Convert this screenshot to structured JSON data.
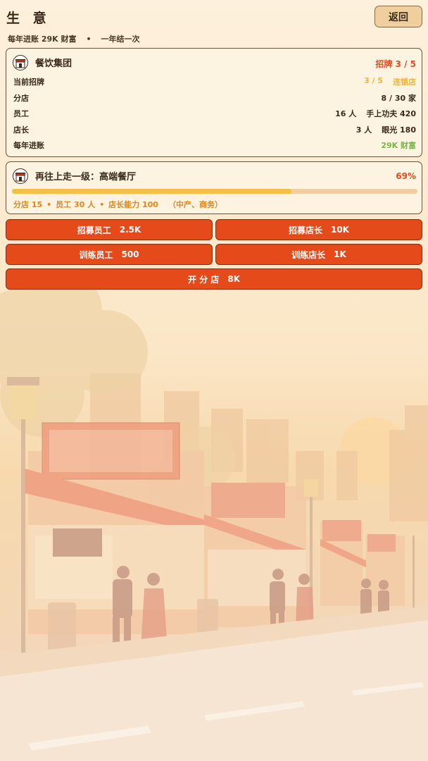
{
  "header": {
    "title": "生 意",
    "back_label": "返回",
    "income_label": "每年进账 29K 财富",
    "separator": "•",
    "cycle_label": "一年结一次"
  },
  "group_card": {
    "icon": "shop-icon",
    "title": "餐饮集团",
    "badge": "招牌 3 / 5",
    "rows": [
      {
        "label": "当前招牌",
        "value_a": "3 / 5",
        "value_b": "连锁店"
      },
      {
        "label": "分店",
        "value_a": "",
        "value_b": "8 / 30 家"
      },
      {
        "label": "员工",
        "value_a": "16 人",
        "value_b": "手上功夫 420"
      },
      {
        "label": "店长",
        "value_a": "3 人",
        "value_b": "眼光 180"
      },
      {
        "label": "每年进账",
        "value_a": "",
        "value_b": "29K 财富"
      }
    ]
  },
  "next_card": {
    "icon": "shop-icon",
    "title": "再往上走一级：高端餐厅",
    "progress_label": "69%",
    "progress": 0.69,
    "req_branches": "分店 15",
    "req_staff": "员工 30 人",
    "req_manager": "店长能力 100",
    "req_dot": "•",
    "req_tags": "（中产、商务）"
  },
  "actions": {
    "recruit_staff": {
      "label": "招募员工",
      "cost": "2.5K"
    },
    "recruit_manager": {
      "label": "招募店长",
      "cost": "10K"
    },
    "train_staff": {
      "label": "训练员工",
      "cost": "500"
    },
    "train_manager": {
      "label": "训练店长",
      "cost": "1K"
    },
    "open_branch": {
      "label": "开 分 店",
      "cost": "8K"
    }
  },
  "colors": {
    "accent": "#e54b1a",
    "gold": "#f0b33e",
    "green": "#79b64a",
    "progress_fill": "#f5be46",
    "progress_track": "#f2cda2"
  }
}
